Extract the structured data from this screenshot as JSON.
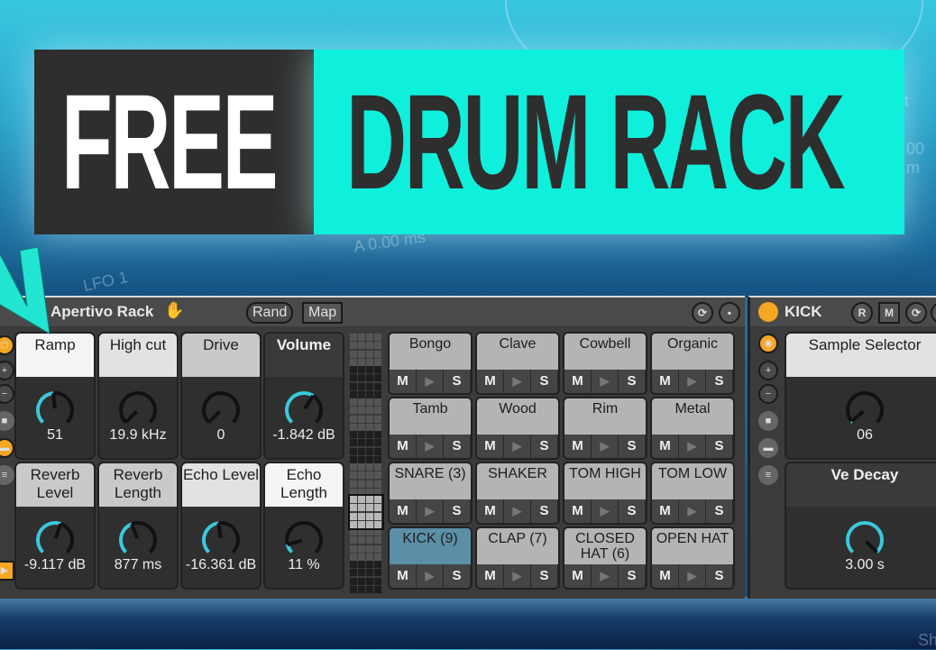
{
  "thumbnail": {
    "title_left": "FREE",
    "title_right": "DRUM RACK",
    "colors": {
      "accent": "#0ef0dc",
      "dark": "#2e2e2e",
      "knob_arc": "#3cc8dc",
      "orange": "#f5a623",
      "active_pad": "#5b8fa6"
    },
    "background_labels": [
      "LFO 1",
      "A 0.00 ms",
      "t",
      "00 m",
      "Sh"
    ]
  },
  "rack": {
    "title": "Apertivo Rack",
    "hand_icon": "hand-icon",
    "rand_label": "Rand",
    "map_label": "Map",
    "header_icons": [
      "refresh-icon",
      "save-icon"
    ],
    "side_icons": [
      "power-icon",
      "plus-icon",
      "minus-icon",
      "camera-icon",
      "minimize-icon",
      "list-icon",
      "expand-icon"
    ],
    "macros": [
      {
        "label": "Ramp",
        "value": "51",
        "fraction": 0.48
      },
      {
        "label": "High cut",
        "value": "19.9 kHz",
        "fraction": 0.0
      },
      {
        "label": "Drive",
        "value": "0",
        "fraction": 0.0
      },
      {
        "label": "Volume",
        "value": "-1.842 dB",
        "fraction": 0.62
      },
      {
        "label": "Reverb Level",
        "value": "-9.117 dB",
        "fraction": 0.57
      },
      {
        "label": "Reverb Length",
        "value": "877 ms",
        "fraction": 0.42
      },
      {
        "label": "Echo Level",
        "value": "-16.361 dB",
        "fraction": 0.47
      },
      {
        "label": "Echo Length",
        "value": "11 %",
        "fraction": 0.11
      }
    ],
    "mini_grid_selected_block": 5,
    "pads": [
      {
        "name": "Bongo",
        "active": false
      },
      {
        "name": "Clave",
        "active": false
      },
      {
        "name": "Cowbell",
        "active": false
      },
      {
        "name": "Organic",
        "active": false
      },
      {
        "name": "Tamb",
        "active": false
      },
      {
        "name": "Wood",
        "active": false
      },
      {
        "name": "Rim",
        "active": false
      },
      {
        "name": "Metal",
        "active": false
      },
      {
        "name": "SNARE (3)",
        "active": false
      },
      {
        "name": "SHAKER",
        "active": false
      },
      {
        "name": "TOM HIGH",
        "active": false
      },
      {
        "name": "TOM LOW",
        "active": false
      },
      {
        "name": "KICK (9)",
        "active": true
      },
      {
        "name": "CLAP (7)",
        "active": false
      },
      {
        "name": "CLOSED HAT (6)",
        "active": false
      },
      {
        "name": "OPEN HAT",
        "active": false
      }
    ],
    "pad_mute": "M",
    "pad_play": "▶",
    "pad_solo": "S"
  },
  "chain": {
    "title": "KICK",
    "r_label": "R",
    "m_label": "M",
    "side_icons": [
      "power-icon",
      "plus-icon",
      "minus-icon",
      "camera-icon",
      "minimize-icon",
      "list-icon"
    ],
    "macros": [
      {
        "label": "Sample Selector",
        "value": "06",
        "fraction": 0.02
      },
      {
        "label": "Ve Decay",
        "value": "3.00 s",
        "fraction": 1.0
      }
    ]
  }
}
